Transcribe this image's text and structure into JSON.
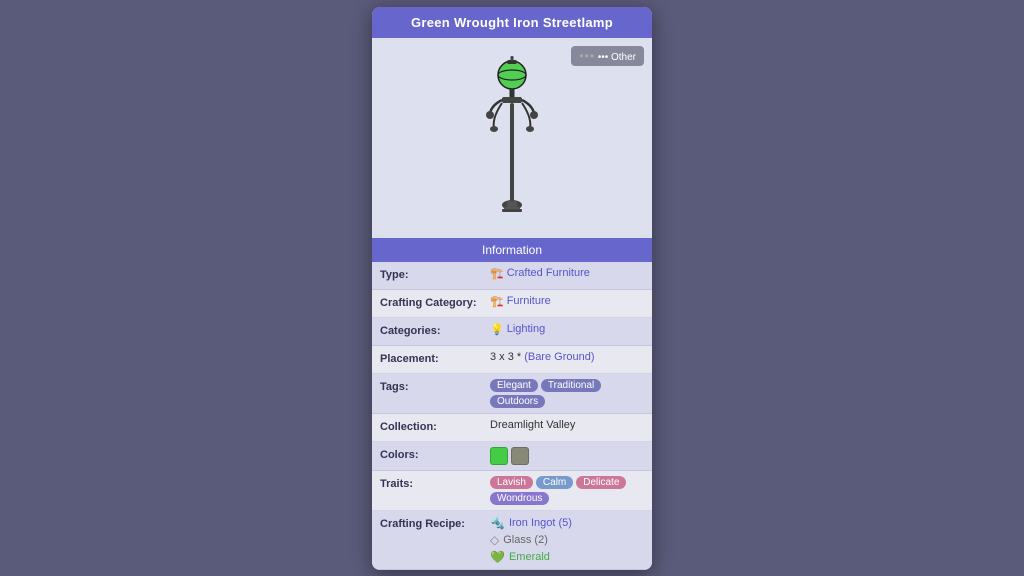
{
  "panel": {
    "title": "Green Wrought Iron Streetlamp",
    "badge": "••• Other",
    "info_header": "Information"
  },
  "rows": [
    {
      "label": "Type:",
      "type": "link",
      "icon": "🏗️",
      "value": "Crafted Furniture"
    },
    {
      "label": "Crafting Category:",
      "type": "link",
      "icon": "🏗️",
      "value": "Furniture"
    },
    {
      "label": "Categories:",
      "type": "link",
      "icon": "💡",
      "value": "Lighting"
    },
    {
      "label": "Placement:",
      "type": "placement",
      "value": "3 x 3 *",
      "ground": "(Bare Ground)"
    },
    {
      "label": "Tags:",
      "type": "tags",
      "values": [
        "Elegant",
        "Traditional",
        "Outdoors"
      ]
    },
    {
      "label": "Collection:",
      "type": "text",
      "value": "Dreamlight Valley"
    },
    {
      "label": "Colors:",
      "type": "colors",
      "values": [
        "#44cc44",
        "#888877"
      ]
    },
    {
      "label": "Traits:",
      "type": "traits",
      "values": [
        {
          "label": "Lavish",
          "class": "trait-lavish"
        },
        {
          "label": "Calm",
          "class": "trait-calm"
        },
        {
          "label": "Delicate",
          "class": "trait-delicate"
        },
        {
          "label": "Wondrous",
          "class": "trait-wondrous"
        }
      ]
    },
    {
      "label": "Crafting Recipe:",
      "type": "recipe",
      "items": [
        {
          "icon": "🔩",
          "color": "#5555cc",
          "text": "Iron Ingot (5)"
        },
        {
          "icon": "◇",
          "color": "#555",
          "text": "Glass (2)"
        },
        {
          "icon": "💚",
          "color": "#44aa44",
          "text": "Emerald"
        }
      ]
    }
  ]
}
